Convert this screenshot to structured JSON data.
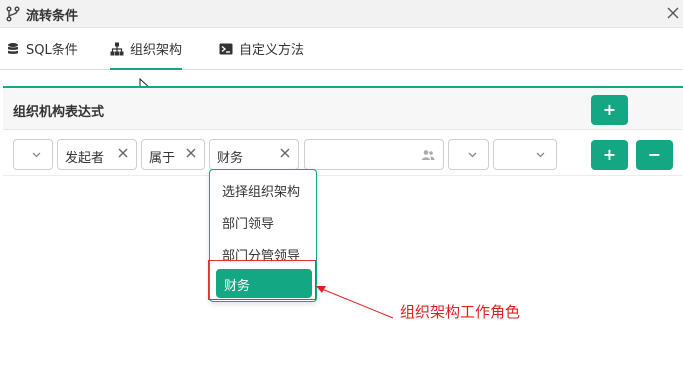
{
  "dialog": {
    "title": "流转条件",
    "title_icon": "branch-icon",
    "close_icon": "close-icon"
  },
  "tabs": [
    {
      "label": "SQL条件",
      "icon": "database-icon",
      "active": false
    },
    {
      "label": "组织架构",
      "icon": "org-chart-icon",
      "active": true
    },
    {
      "label": "自定义方法",
      "icon": "terminal-icon",
      "active": false
    }
  ],
  "section": {
    "title": "组织机构表达式",
    "add_label": "+"
  },
  "condition_row": {
    "bracket_select": {
      "value": ""
    },
    "initiator_tag": {
      "value": "发起者"
    },
    "operator_tag": {
      "value": "属于"
    },
    "role_tag": {
      "value": "财务"
    },
    "user_picker": {
      "value": ""
    },
    "logic_select": {
      "value": ""
    },
    "close_bracket_select": {
      "value": ""
    },
    "add_label": "+",
    "remove_label": "−"
  },
  "dropdown": {
    "items": [
      "选择组织架构",
      "部门领导",
      "部门分管领导"
    ],
    "selected": "财务"
  },
  "annotation": {
    "text": "组织架构工作角色",
    "color": "#e02020"
  },
  "colors": {
    "accent": "#13a883",
    "annotation_red": "#e02020"
  }
}
